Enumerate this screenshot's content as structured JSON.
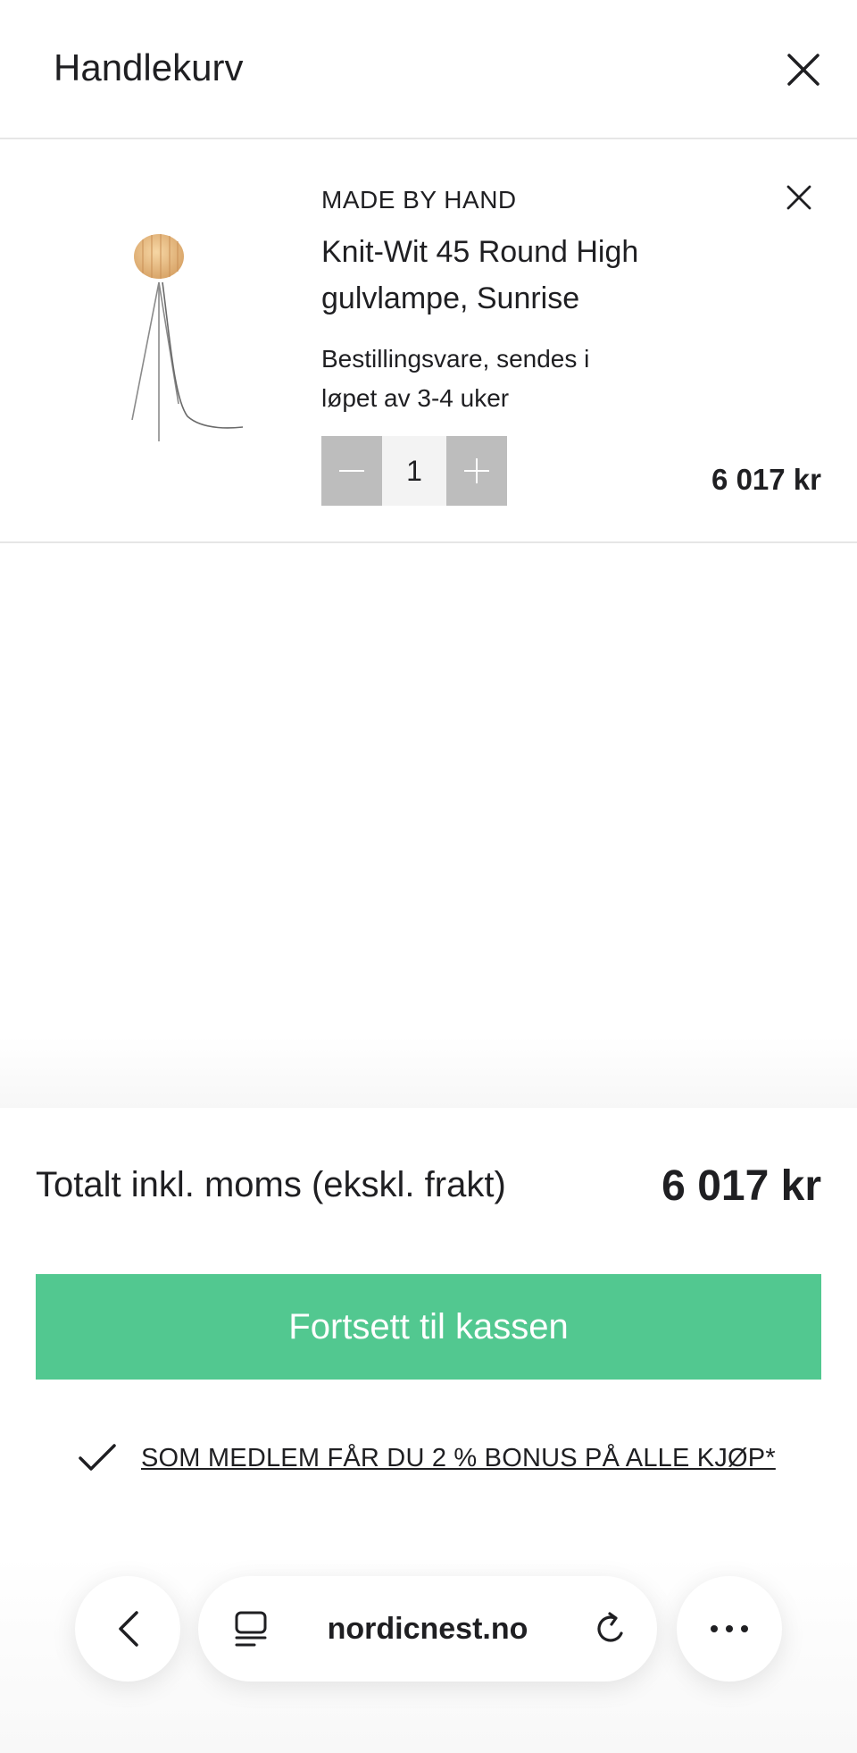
{
  "header": {
    "title": "Handlekurv"
  },
  "cart_item": {
    "brand": "MADE BY HAND",
    "name": "Knit-Wit 45 Round High gulvlampe, Sunrise",
    "delivery": "Bestillingsvare, sendes i løpet av 3-4 uker",
    "quantity": "1",
    "price": "6 017 kr"
  },
  "summary": {
    "total_label": "Totalt inkl. moms (ekskl. frakt)",
    "total_value": "6 017 kr",
    "checkout_label": "Fortsett til kassen",
    "member_text": "SOM MEDLEM FÅR DU 2 % BONUS PÅ ALLE KJØP*"
  },
  "browser": {
    "url": "nordicnest.no"
  },
  "colors": {
    "accent": "#52c890",
    "qty_button": "#bdbdbd",
    "text": "#1f1f22"
  },
  "icons": [
    "close-icon",
    "remove-item-icon",
    "minus-icon",
    "plus-icon",
    "checkmark-icon",
    "back-arrow-icon",
    "tabs-icon",
    "reload-icon",
    "more-icon"
  ]
}
